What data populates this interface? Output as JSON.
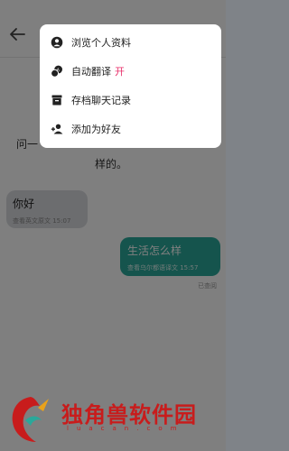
{
  "chat": {
    "intro_line1": "问一",
    "intro_line2": "样的。",
    "incoming": {
      "text": "你好",
      "meta": "查看英文原文 15:07"
    },
    "outgoing": {
      "text": "生活怎么样",
      "meta": "查看乌尔都语译文 15:57"
    },
    "read_status": "已查阅"
  },
  "menu": {
    "items": [
      {
        "icon": "profile-icon",
        "label": "浏览个人资料"
      },
      {
        "icon": "translate-icon",
        "label": "自动翻译",
        "badge": "开"
      },
      {
        "icon": "archive-icon",
        "label": "存档聊天记录"
      },
      {
        "icon": "add-friend-icon",
        "label": "添加为好友"
      }
    ]
  },
  "watermark": {
    "brand": "独角兽软件园",
    "url": "luacan.com"
  },
  "colors": {
    "accent": "#2aa89a",
    "badge": "#e8316b",
    "watermark": "#c81c1c"
  }
}
